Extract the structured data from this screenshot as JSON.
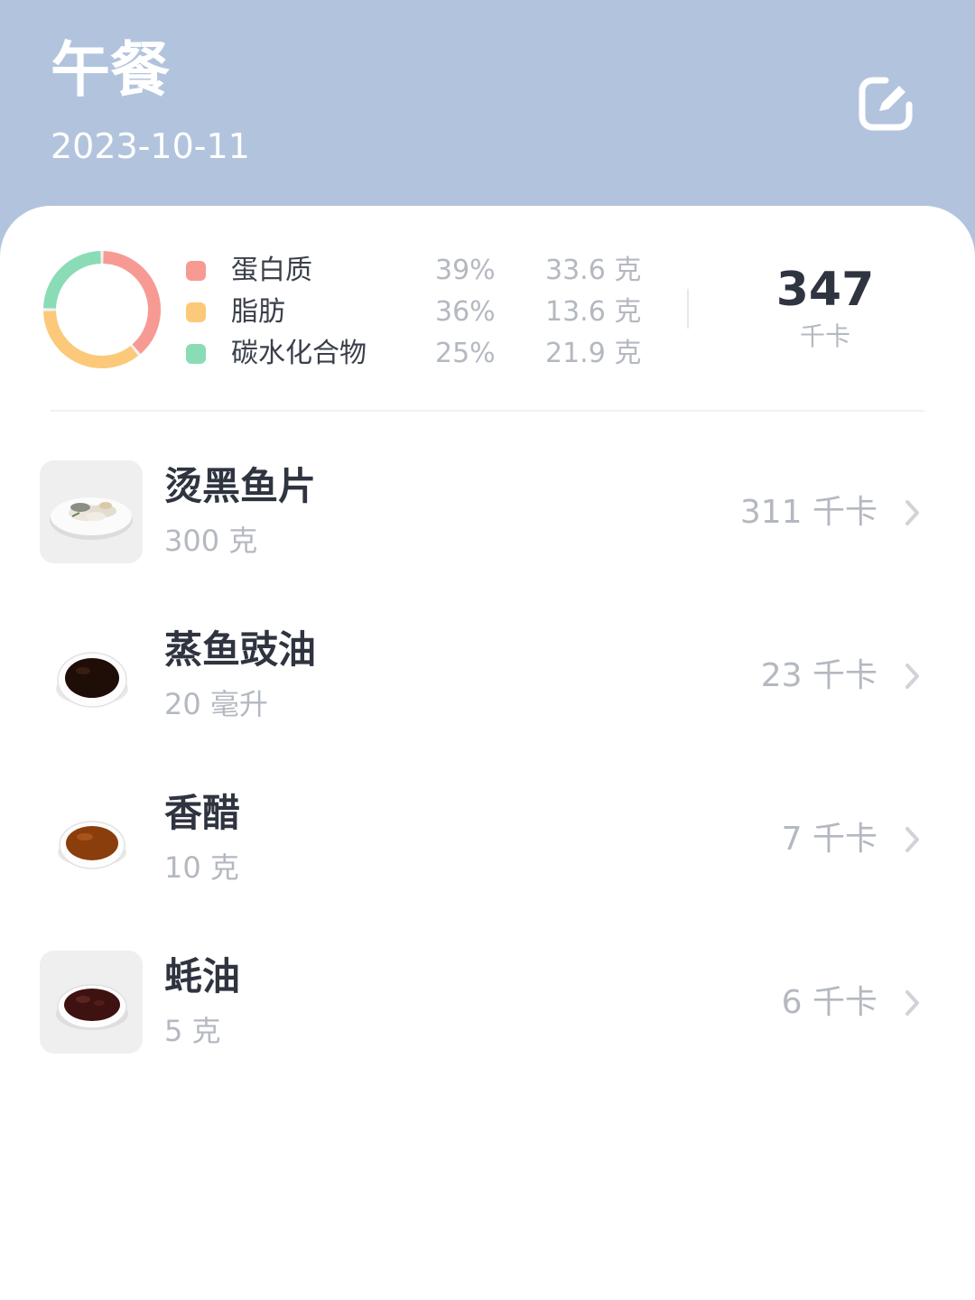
{
  "header": {
    "title": "午餐",
    "date": "2023-10-11",
    "edit_icon": "edit-icon"
  },
  "summary": {
    "macros": [
      {
        "name": "蛋白质",
        "percent": "39%",
        "amount": "33.6 克",
        "color": "#f79a94"
      },
      {
        "name": "脂肪",
        "percent": "36%",
        "amount": "13.6 克",
        "color": "#fcc97a"
      },
      {
        "name": "碳水化合物",
        "percent": "25%",
        "amount": "21.9 克",
        "color": "#8adcb6"
      }
    ],
    "total_calories": "347",
    "calorie_unit": "千卡"
  },
  "foods": [
    {
      "name": "烫黑鱼片",
      "amount": "300 克",
      "calories": "311 千卡",
      "thumb": "fish-slices-plate"
    },
    {
      "name": "蒸鱼豉油",
      "amount": "20 毫升",
      "calories": "23 千卡",
      "thumb": "soy-sauce-dish"
    },
    {
      "name": "香醋",
      "amount": "10 克",
      "calories": "7 千卡",
      "thumb": "vinegar-dish"
    },
    {
      "name": "蚝油",
      "amount": "5 克",
      "calories": "6 千卡",
      "thumb": "oyster-sauce-dish"
    }
  ]
}
